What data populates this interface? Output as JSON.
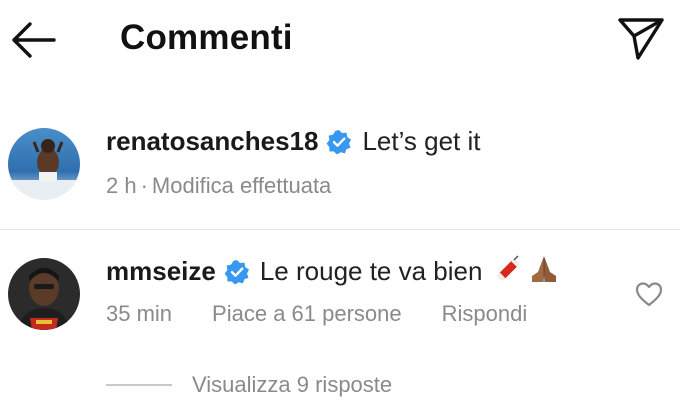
{
  "header": {
    "title": "Commenti",
    "back_icon": "arrow-left-icon",
    "send_icon": "paper-plane-icon"
  },
  "comments": [
    {
      "username": "renatosanches18",
      "verified": true,
      "text": "Let’s get it",
      "time": "2 h",
      "separator": "·",
      "edited": "Modifica effettuata"
    },
    {
      "username": "mmseize",
      "verified": true,
      "text": "Le rouge te va bien",
      "emojis": [
        "firecracker",
        "folded-hands"
      ],
      "time": "35 min",
      "likes": "Piace a 61 persone",
      "reply": "Rispondi"
    }
  ],
  "replies_link": "Visualizza 9 risposte",
  "colors": {
    "verified_blue": "#3897f0",
    "meta_gray": "#8a8a8a",
    "text": "#111111"
  }
}
